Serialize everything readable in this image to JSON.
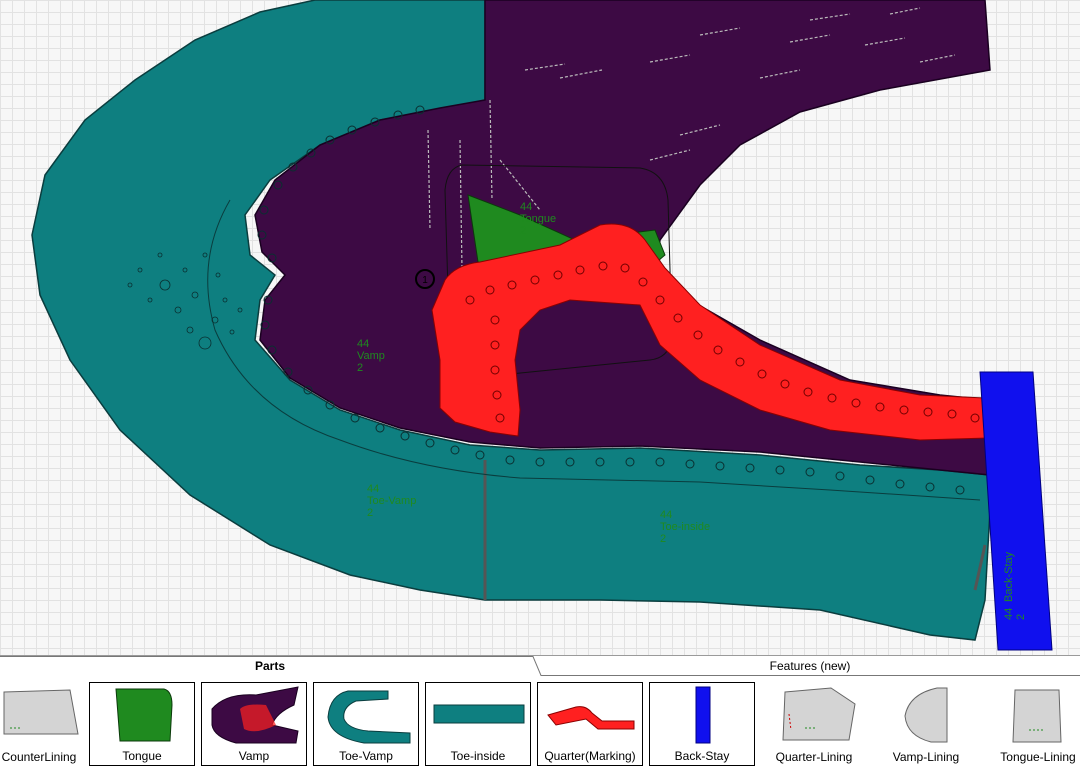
{
  "canvas": {
    "parts": [
      {
        "size": "44",
        "name": "Tongue",
        "qty": "2"
      },
      {
        "size": "44",
        "name": "Vamp",
        "qty": "2"
      },
      {
        "size": "44",
        "name": "Toe-Vamp",
        "qty": "2"
      },
      {
        "size": "44",
        "name": "Toe-inside",
        "qty": "2"
      },
      {
        "size": "44",
        "name": "Back-Stay",
        "qty": "2"
      }
    ],
    "marker_number": "1"
  },
  "panel": {
    "tabs": {
      "parts": "Parts",
      "features": "Features (new)"
    },
    "thumbnails": [
      {
        "label": "CounterLining",
        "color": "#d4d4d4"
      },
      {
        "label": "Tongue",
        "color": "#1f8a1f"
      },
      {
        "label": "Vamp",
        "color": "#3d0a44"
      },
      {
        "label": "Toe-Vamp",
        "color": "#0e7f80"
      },
      {
        "label": "Toe-inside",
        "color": "#0e7f80"
      },
      {
        "label": "Quarter(Marking)",
        "color": "#ff2020"
      },
      {
        "label": "Back-Stay",
        "color": "#1010ee"
      },
      {
        "label": "Quarter-Lining",
        "color": "#d4d4d4"
      },
      {
        "label": "Vamp-Lining",
        "color": "#d4d4d4"
      },
      {
        "label": "Tongue-Lining",
        "color": "#d4d4d4"
      }
    ]
  },
  "colors": {
    "teal": "#0e7f80",
    "vamp": "#3d0a44",
    "quarter": "#ff2020",
    "tongue": "#1f8a1f",
    "backstay": "#1010ee"
  }
}
